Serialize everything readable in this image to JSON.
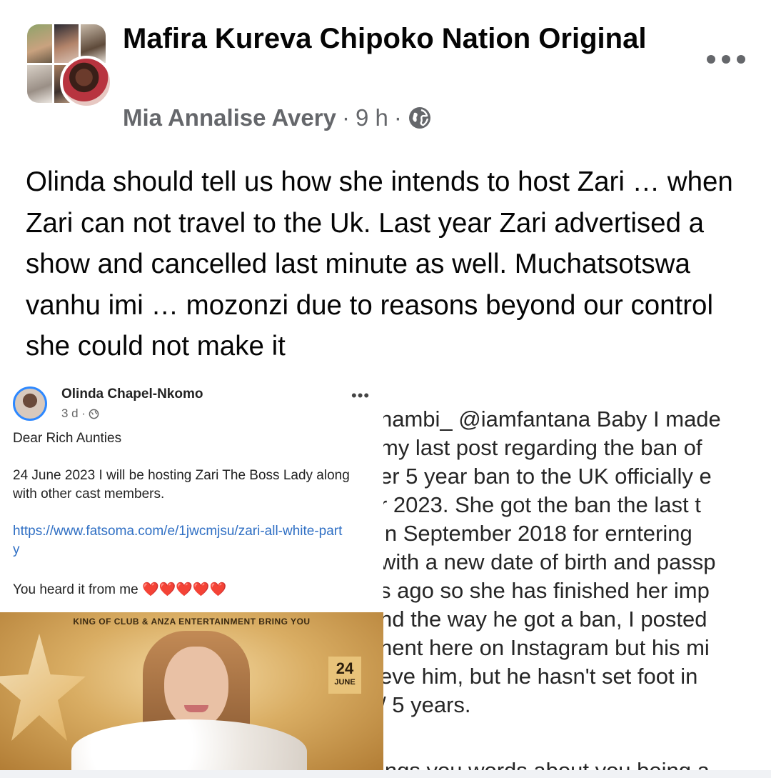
{
  "header": {
    "group_name": "Mafira Kureva Chipoko Nation Original",
    "author": "Mia Annalise Avery",
    "time": "9 h",
    "separator": "·",
    "privacy_icon": "globe-icon",
    "more_icon": "more-horizontal-icon"
  },
  "post": {
    "text": "Olinda should tell us how she intends to host Zari … when Zari can not travel to the Uk. Last year Zari advertised a show and cancelled last minute as well. Muchatsotswa vanhu imi … mozonzi due to reasons beyond our control she could not make it"
  },
  "attachment": {
    "facebook_post": {
      "name": "Olinda Chapel-Nkomo",
      "time": "3 d ·",
      "more": "•••",
      "greeting": "Dear Rich Aunties",
      "body": "24 June 2023 I will be hosting Zari The Boss Lady along with other cast members.",
      "link": "https://www.fatsoma.com/e/1jwcmjsu/zari-all-white-party",
      "closing": "You heard it from me ❤️❤️❤️❤️❤️",
      "poster": {
        "banner": "KING OF CLUB & ANZA ENTERTAINMENT BRING YOU",
        "date_day": "24",
        "date_month": "JUNE"
      }
    },
    "instagram_comment": {
      "lines": [
        "nambi_ @iamfantana Baby I made",
        "my last post regarding the ban of",
        "er 5 year ban to the UK officially e",
        "r 2023. She got the ban the last t",
        " in September 2018 for erntering",
        "with a new date of birth and passp",
        "s ago so she has finished her imp",
        "nd the way he got a ban, I posted",
        "nent here on Instagram but his mi",
        "eve him, but he hasn't set foot in",
        "/ 5 years.",
        "",
        "ings you words about you being a"
      ]
    }
  }
}
